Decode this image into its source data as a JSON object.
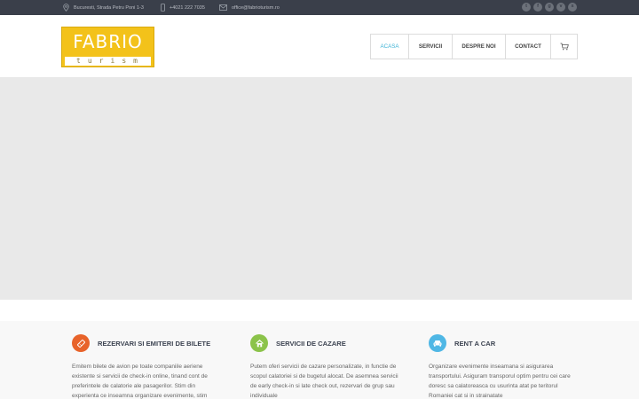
{
  "topbar": {
    "address": "Bucuresti, Strada Petru Poni 1-3",
    "phone": "+4021 222 7035",
    "email": "office@fabrioturism.ro",
    "social_icons": [
      "twitter-icon",
      "facebook-icon",
      "google-plus-icon",
      "vimeo-icon",
      "skype-icon"
    ],
    "social_glyphs": [
      "t",
      "f",
      "g",
      "v",
      "s"
    ]
  },
  "logo": {
    "line1": "FABRIO",
    "line2": "turism"
  },
  "nav": {
    "items": [
      {
        "label": "ACASA"
      },
      {
        "label": "SERVICII"
      },
      {
        "label": "DESPRE NOI"
      },
      {
        "label": "CONTACT"
      }
    ],
    "cart_icon": "cart-icon"
  },
  "features": [
    {
      "title": "REZERVARI SI EMITERI DE BILETE",
      "icon": "ticket-icon",
      "color": "#e8632a",
      "text": " Emitem bilete de avion pe toate companiile aeriene existente si servicii de check-in online, tinand cont de preferintele de calatorie ale pasagerilor. Stim din experienta ce inseamna organizare evenimente, stim"
    },
    {
      "title": "SERVICII DE CAZARE",
      "icon": "home-icon",
      "color": "#8bc34a",
      "text": "Putem oferi servicii de cazare personalizate, in functie de scopul calatoriei si de bugetul alocat. De asemnea servicii de early check-in si late check out, rezervari de grup sau individuale"
    },
    {
      "title": "RENT A CAR",
      "icon": "car-icon",
      "color": "#4fb7e5",
      "text": "Organizare evenimente inseamana si asigurarea transportului. Asiguram transporul optim pentru cei care doresc sa calatoreasca cu usurinta atat pe teritorul Romaniei cat si in strainatate"
    }
  ],
  "colors": {
    "topbar_bg": "#3a3f4a",
    "accent": "#3fb3d6",
    "logo_yellow": "#f3c21a"
  }
}
